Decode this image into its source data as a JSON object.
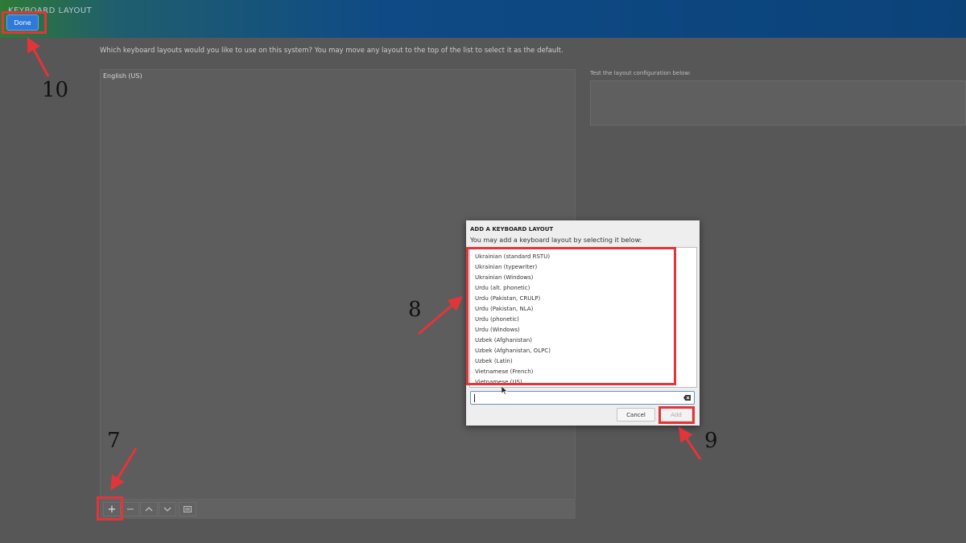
{
  "header": {
    "title": "KEYBOARD LAYOUT",
    "done_label": "Done"
  },
  "main": {
    "instructions": "Which keyboard layouts would you like to use on this system?  You may move any layout to the top of the list to select it as the default.",
    "layouts": [
      "English (US)"
    ],
    "toolbar": {
      "add": "+",
      "remove": "−",
      "move_up": "^",
      "move_down": "v",
      "preview": "▤"
    },
    "test_label": "Test the layout configuration below:"
  },
  "dialog": {
    "title": "ADD A KEYBOARD LAYOUT",
    "subtitle": "You may add a keyboard layout by selecting it below:",
    "items": [
      "Ukrainian (standard RSTU)",
      "Ukrainian (typewriter)",
      "Ukrainian (Windows)",
      "Urdu (alt. phonetic)",
      "Urdu (Pakistan, CRULP)",
      "Urdu (Pakistan, NLA)",
      "Urdu (phonetic)",
      "Urdu (Windows)",
      "Uzbek (Afghanistan)",
      "Uzbek (Afghanistan, OLPC)",
      "Uzbek (Latin)",
      "Vietnamese (French)",
      "Vietnamese (US)"
    ],
    "search_value": "",
    "cancel_label": "Cancel",
    "add_label": "Add"
  },
  "annotations": {
    "step7": "7",
    "step8": "8",
    "step9": "9",
    "step10": "10"
  },
  "colors": {
    "highlight": "#e2353a",
    "accent": "#2f79d8",
    "background": "#575757"
  }
}
